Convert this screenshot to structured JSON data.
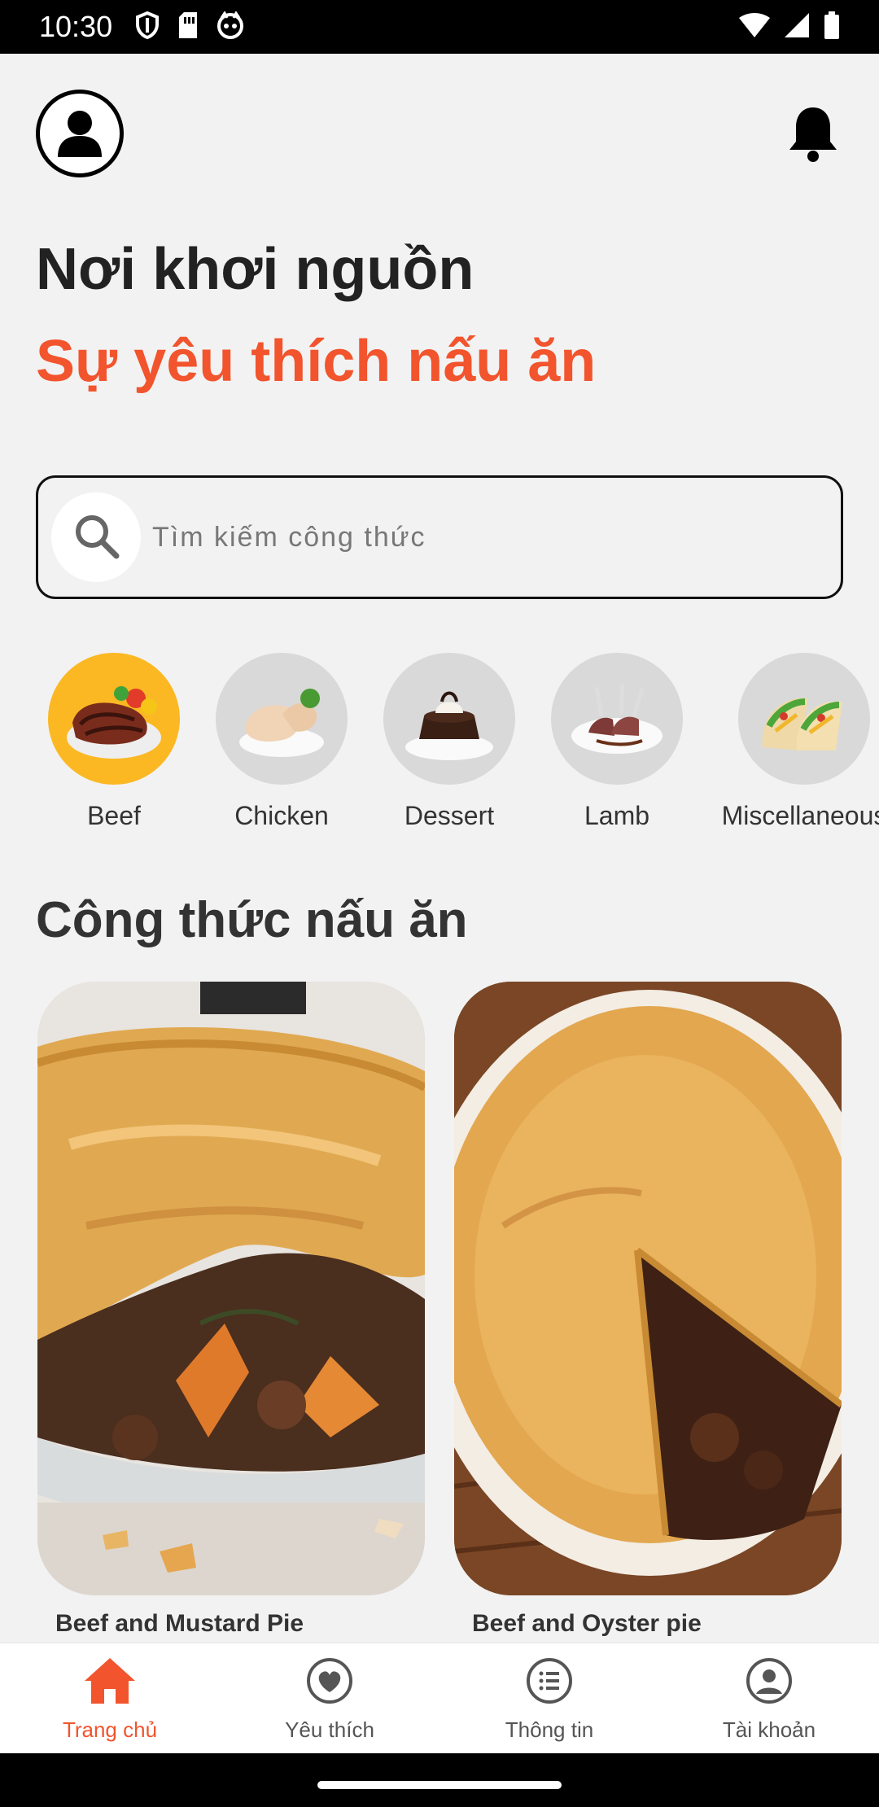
{
  "status_bar": {
    "time": "10:30",
    "left_icons": [
      "shield-icon",
      "sim-card-icon",
      "cat-app-icon"
    ],
    "right_icons": [
      "wifi-icon",
      "signal-icon",
      "battery-icon"
    ]
  },
  "header": {
    "avatar_icon": "user-avatar-icon",
    "bell_icon": "bell-icon"
  },
  "hero": {
    "line1": "Nơi khơi nguồn",
    "line2": "Sự yêu thích nấu ăn",
    "accent_color": "#f2542d"
  },
  "search": {
    "placeholder": "Tìm kiếm công thức",
    "icon": "search-icon"
  },
  "categories": [
    {
      "label": "Beef",
      "active": true
    },
    {
      "label": "Chicken",
      "active": false
    },
    {
      "label": "Dessert",
      "active": false
    },
    {
      "label": "Lamb",
      "active": false
    },
    {
      "label": "Miscellaneous",
      "active": false
    }
  ],
  "recipes_section": {
    "title": "Công thức nấu ăn",
    "items": [
      {
        "name": "Beef and Mustard Pie"
      },
      {
        "name": "Beef and Oyster pie"
      }
    ]
  },
  "bottom_nav": [
    {
      "label": "Trang chủ",
      "icon": "home-icon",
      "active": true
    },
    {
      "label": "Yêu thích",
      "icon": "heart-icon",
      "active": false
    },
    {
      "label": "Thông tin",
      "icon": "list-icon",
      "active": false
    },
    {
      "label": "Tài khoản",
      "icon": "account-icon",
      "active": false
    }
  ],
  "colors": {
    "active_category": "#fbb823",
    "inactive_category": "#d9d9d9",
    "nav_active": "#f2542d"
  }
}
